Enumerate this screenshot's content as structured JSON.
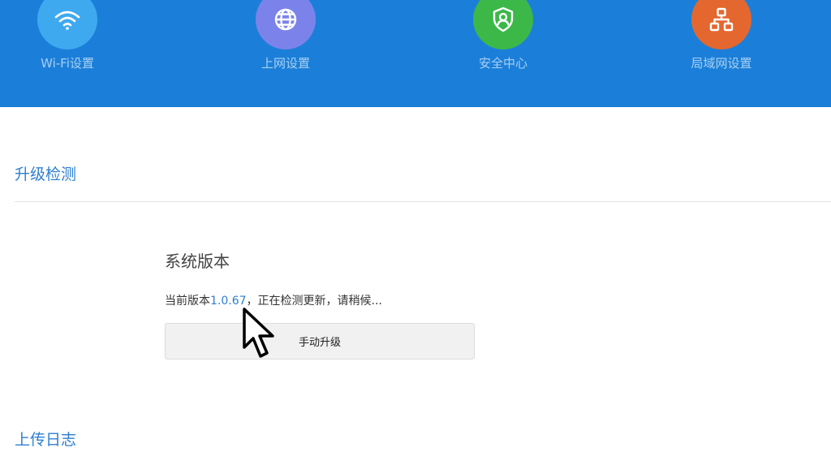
{
  "nav": {
    "items": [
      {
        "label": "Wi-Fi设置",
        "icon": "wifi-icon",
        "color": "#3fa9f0"
      },
      {
        "label": "上网设置",
        "icon": "globe-icon",
        "color": "#7b83ea"
      },
      {
        "label": "安全中心",
        "icon": "shield-user-icon",
        "color": "#3cb848"
      },
      {
        "label": "局域网设置",
        "icon": "lan-network-icon",
        "color": "#e4672f"
      }
    ]
  },
  "upgrade_check": {
    "section_title": "升级检测",
    "system_version_title": "系统版本",
    "status_prefix": "当前版本",
    "version": "1.0.67",
    "status_suffix": "，正在检测更新，请稍候...",
    "manual_upgrade_label": "手动升级"
  },
  "upload_log": {
    "section_title": "上传日志"
  },
  "colors": {
    "header_bg": "#1b7fd9",
    "accent": "#2d7fd0"
  }
}
